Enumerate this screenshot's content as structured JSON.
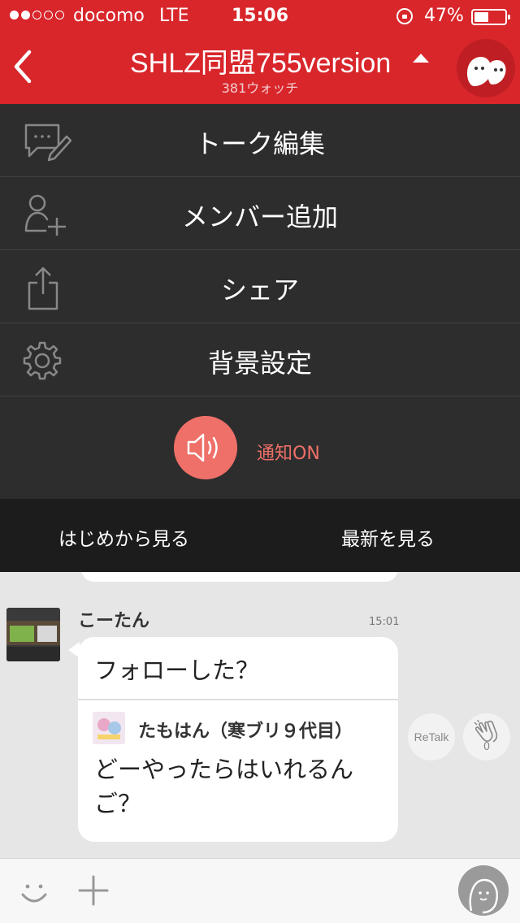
{
  "status_bar": {
    "signal": [
      true,
      true,
      false,
      false,
      false
    ],
    "carrier": "docomo",
    "network": "LTE",
    "time": "15:06",
    "battery": "47%",
    "battery_level": 0.47
  },
  "header": {
    "title": "SHLZ同盟755version",
    "subtitle": "381ウォッチ",
    "background_color": "#d8262b"
  },
  "menu": {
    "items": [
      {
        "label": "トーク編集",
        "icon": "edit-talk-icon"
      },
      {
        "label": "メンバー追加",
        "icon": "add-member-icon"
      },
      {
        "label": "シェア",
        "icon": "share-icon"
      },
      {
        "label": "背景設定",
        "icon": "gear-icon"
      }
    ],
    "notify_label": "通知ON",
    "accent_color": "#ee7068"
  },
  "jump_bar": {
    "from_start": "はじめから見る",
    "latest": "最新を見る"
  },
  "chat": {
    "sender": "こーたん",
    "time": "15:01",
    "message": "フォローした？",
    "reply": {
      "name": "たもはん（寒ブリ９代目）",
      "text": "どーやったらはいれるんご？"
    },
    "retalk_label": "ReTalk",
    "clap_count": "0"
  }
}
